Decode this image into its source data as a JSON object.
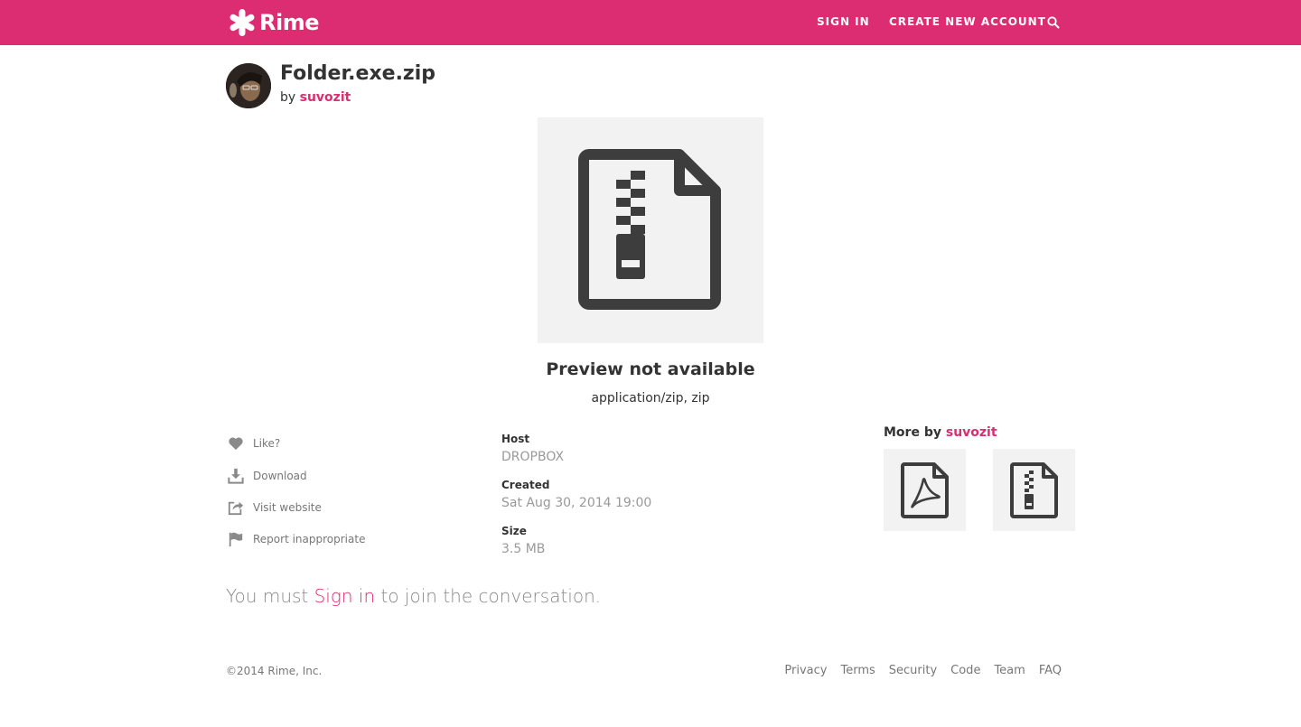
{
  "brand": {
    "name": "Rime",
    "accent_color": "#dc2d72"
  },
  "nav": {
    "sign_in": "SIGN IN",
    "create_account": "CREATE NEW ACCOUNT",
    "search_icon": "search-icon"
  },
  "file": {
    "title": "Folder.exe.zip",
    "by_prefix": "by",
    "author": "suvozit"
  },
  "preview": {
    "title": "Preview not available",
    "type": "application/zip, zip",
    "icon": "zip-file-icon"
  },
  "actions": [
    {
      "label": "Like?",
      "icon": "heart-icon"
    },
    {
      "label": "Download",
      "icon": "download-icon"
    },
    {
      "label": "Visit website",
      "icon": "share-icon"
    },
    {
      "label": "Report inappropriate",
      "icon": "flag-icon"
    }
  ],
  "meta": {
    "host_label": "Host",
    "host_value": "DROPBOX",
    "created_label": "Created",
    "created_value": "Sat Aug 30, 2014 19:00",
    "size_label": "Size",
    "size_value": "3.5 MB"
  },
  "more": {
    "prefix": "More by",
    "author": "suvozit",
    "items": [
      "pdf-file-icon",
      "zip-file-icon"
    ]
  },
  "signin_message": {
    "before": "You must",
    "link": "Sign in",
    "after": "to join the conversation."
  },
  "footer": {
    "copyright": "©2014 Rime, Inc.",
    "links": [
      "Privacy",
      "Terms",
      "Security",
      "Code",
      "Team",
      "FAQ"
    ]
  }
}
